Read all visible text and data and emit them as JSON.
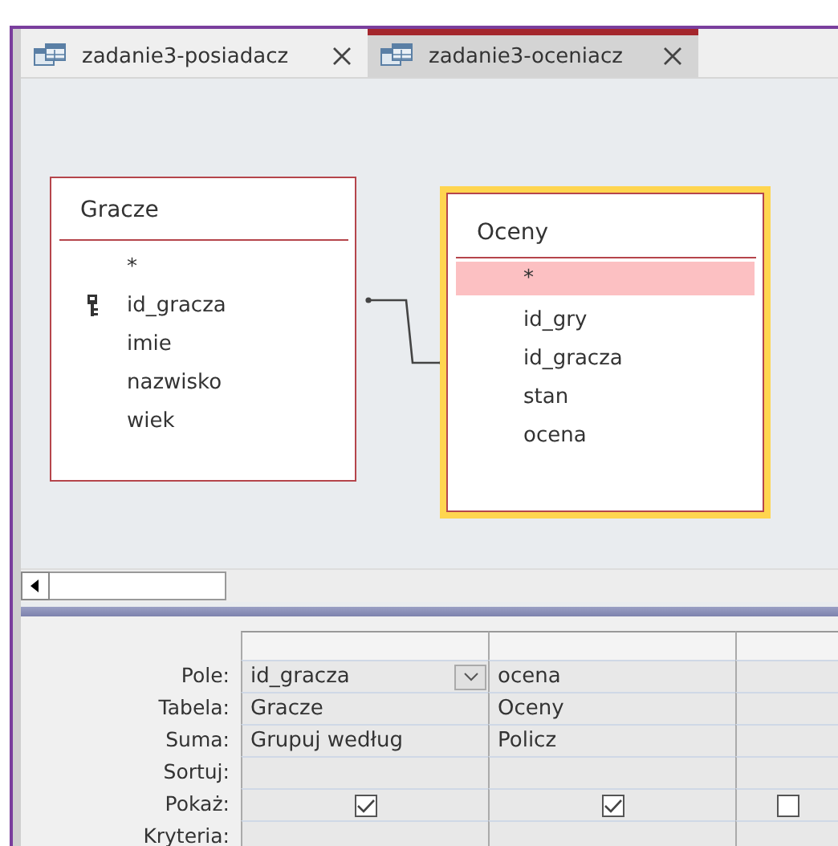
{
  "tabs": [
    {
      "label": "zadanie3-posiadacz",
      "selected": false
    },
    {
      "label": "zadanie3-oceniacz",
      "selected": true
    }
  ],
  "tables": [
    {
      "title": "Gracze",
      "selected": false,
      "fields": [
        {
          "name": "*",
          "key": false,
          "selected": false
        },
        {
          "name": "id_gracza",
          "key": true,
          "selected": false
        },
        {
          "name": "imie",
          "key": false,
          "selected": false
        },
        {
          "name": "nazwisko",
          "key": false,
          "selected": false
        },
        {
          "name": "wiek",
          "key": false,
          "selected": false
        }
      ]
    },
    {
      "title": "Oceny",
      "selected": true,
      "fields": [
        {
          "name": "*",
          "key": false,
          "selected": true
        },
        {
          "name": "id_gry",
          "key": false,
          "selected": false
        },
        {
          "name": "id_gracza",
          "key": false,
          "selected": false
        },
        {
          "name": "stan",
          "key": false,
          "selected": false
        },
        {
          "name": "ocena",
          "key": false,
          "selected": false
        }
      ]
    }
  ],
  "grid": {
    "row_labels": [
      "Pole:",
      "Tabela:",
      "Suma:",
      "Sortuj:",
      "Pokaż:",
      "Kryteria:"
    ],
    "columns": [
      {
        "field": "id_gracza",
        "table": "Gracze",
        "total": "Grupuj według",
        "show": true,
        "dropdown": true
      },
      {
        "field": "ocena",
        "table": "Oceny",
        "total": "Policz",
        "show": true,
        "dropdown": false
      },
      {
        "show": false,
        "dropdown": false
      }
    ]
  }
}
